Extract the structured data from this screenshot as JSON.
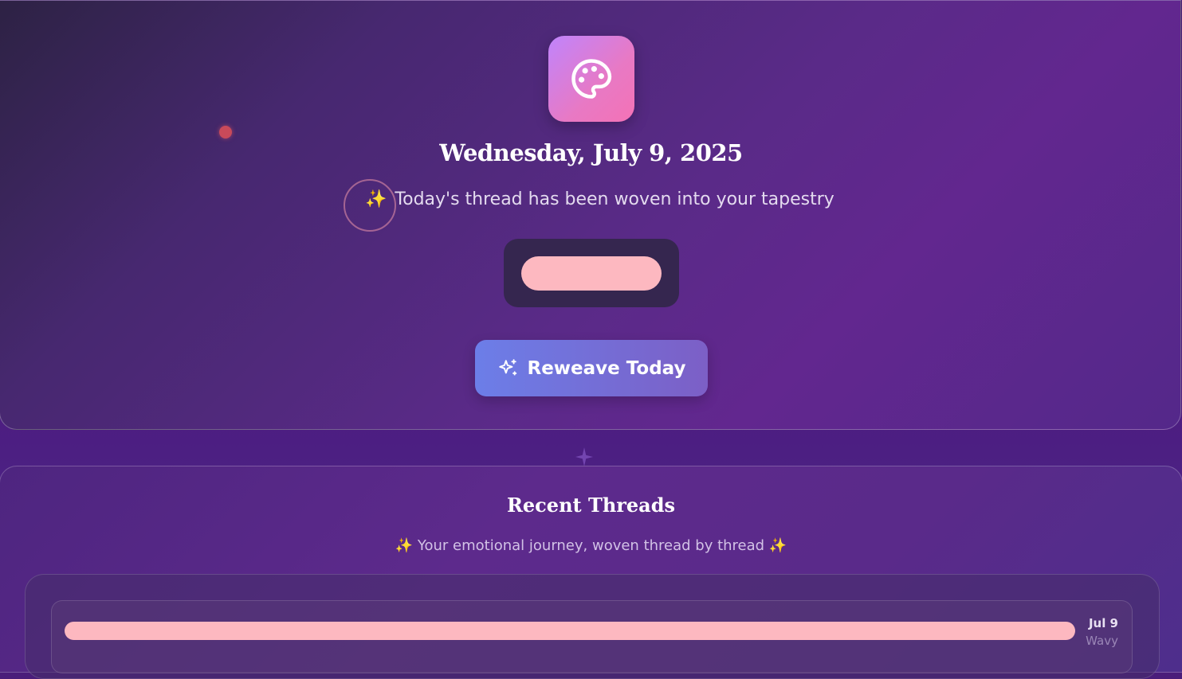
{
  "hero": {
    "app_icon": "palette-icon",
    "date": "Wednesday, July 9, 2025",
    "status_emoji": "✨",
    "status_text": "Today's thread has been woven into your tapestry",
    "today_thread_color": "#fdb8c0",
    "reweave_icon": "sparkles-icon",
    "reweave_label": "Reweave Today"
  },
  "recent": {
    "title": "Recent Threads",
    "subtitle_emoji": "✨",
    "subtitle": "Your emotional journey, woven thread by thread",
    "threads": [
      {
        "date": "Jul 9",
        "mood": "Wavy",
        "color": "#fdb8c0"
      }
    ]
  },
  "colors": {
    "accent_gradient_start": "#6c7ee8",
    "accent_gradient_end": "#7c5fc6",
    "icon_gradient_start": "#c084fc",
    "icon_gradient_end": "#f472b6"
  }
}
